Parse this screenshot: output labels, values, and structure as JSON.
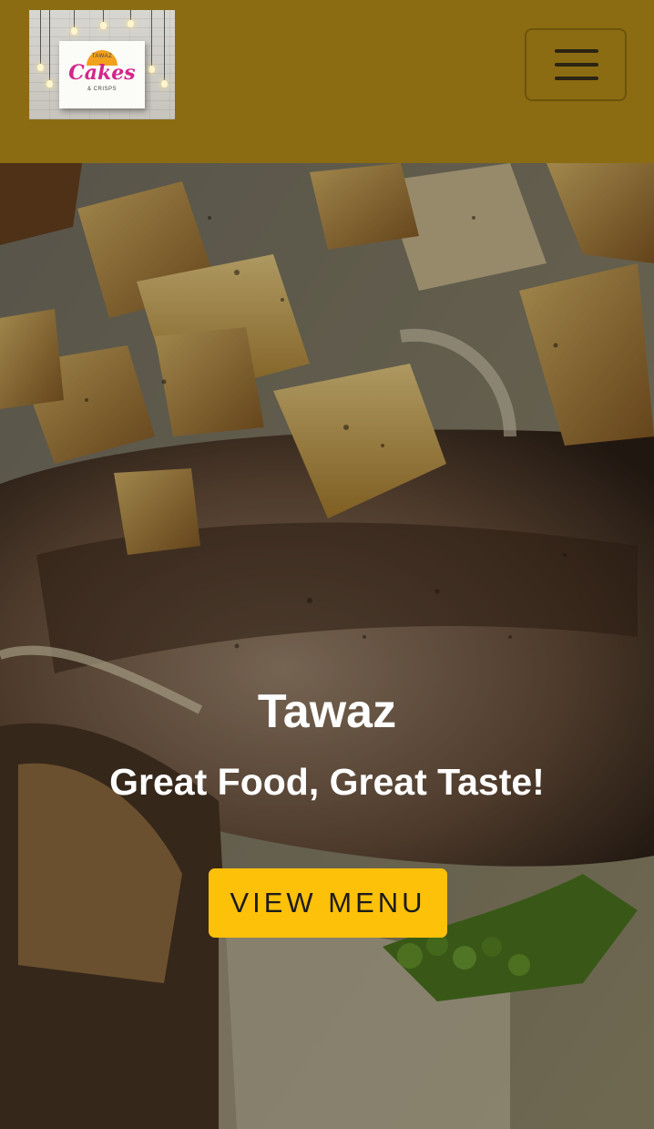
{
  "header": {
    "logo": {
      "small_top": "TAWAZ",
      "brand": "Cakes",
      "small_bottom": "& CRISPS"
    },
    "menu_toggle": {
      "icon": "hamburger-icon"
    }
  },
  "hero": {
    "title": "Tawaz",
    "subtitle": "Great Food, Great Taste!",
    "cta_label": "VIEW MENU"
  },
  "colors": {
    "navbar": "#8b6c12",
    "cta": "#fec10a",
    "text_light": "#ffffff"
  }
}
